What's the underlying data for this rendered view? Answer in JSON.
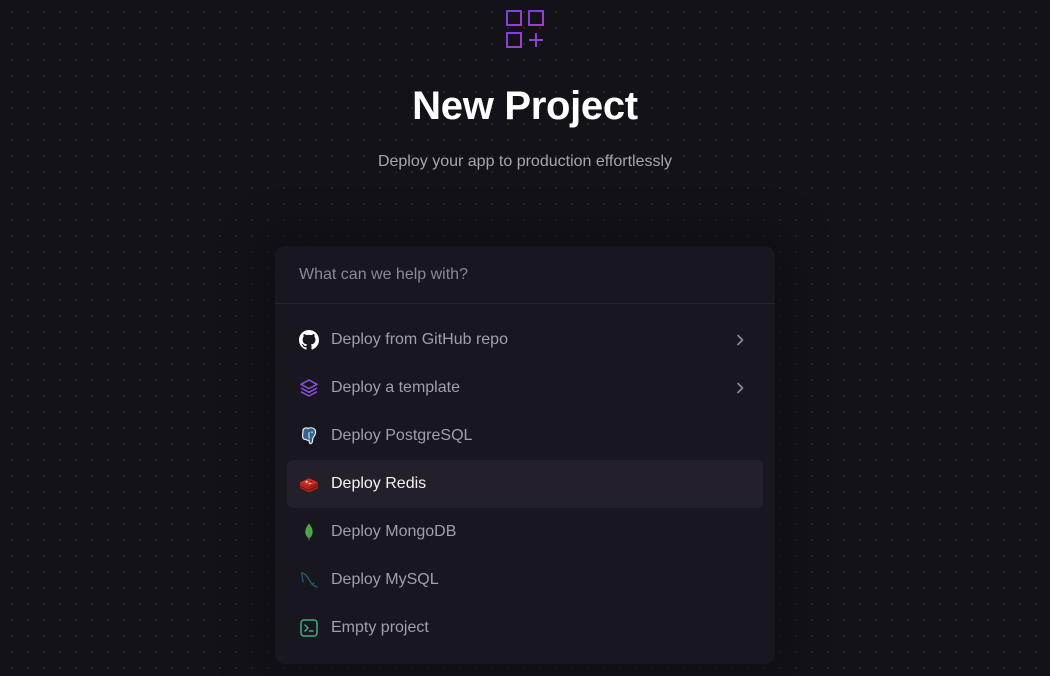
{
  "header": {
    "logo_icon": "grid-plus-icon",
    "title": "New Project",
    "subtitle": "Deploy your app to production effortlessly"
  },
  "search": {
    "placeholder": "What can we help with?",
    "value": ""
  },
  "options": [
    {
      "label": "Deploy from GitHub repo",
      "icon": "github-icon",
      "has_chevron": true
    },
    {
      "label": "Deploy a template",
      "icon": "layers-icon",
      "has_chevron": true
    },
    {
      "label": "Deploy PostgreSQL",
      "icon": "postgresql-icon",
      "has_chevron": false
    },
    {
      "label": "Deploy Redis",
      "icon": "redis-icon",
      "has_chevron": false,
      "active": true
    },
    {
      "label": "Deploy MongoDB",
      "icon": "mongodb-icon",
      "has_chevron": false
    },
    {
      "label": "Deploy MySQL",
      "icon": "mysql-icon",
      "has_chevron": false
    },
    {
      "label": "Empty project",
      "icon": "terminal-icon",
      "has_chevron": false
    }
  ],
  "colors": {
    "background": "#141219",
    "panel": "#18161e",
    "active_row": "#232029",
    "accent_purple": "#853bce",
    "text_primary": "#ffffff",
    "text_muted": "#a19fa9"
  }
}
